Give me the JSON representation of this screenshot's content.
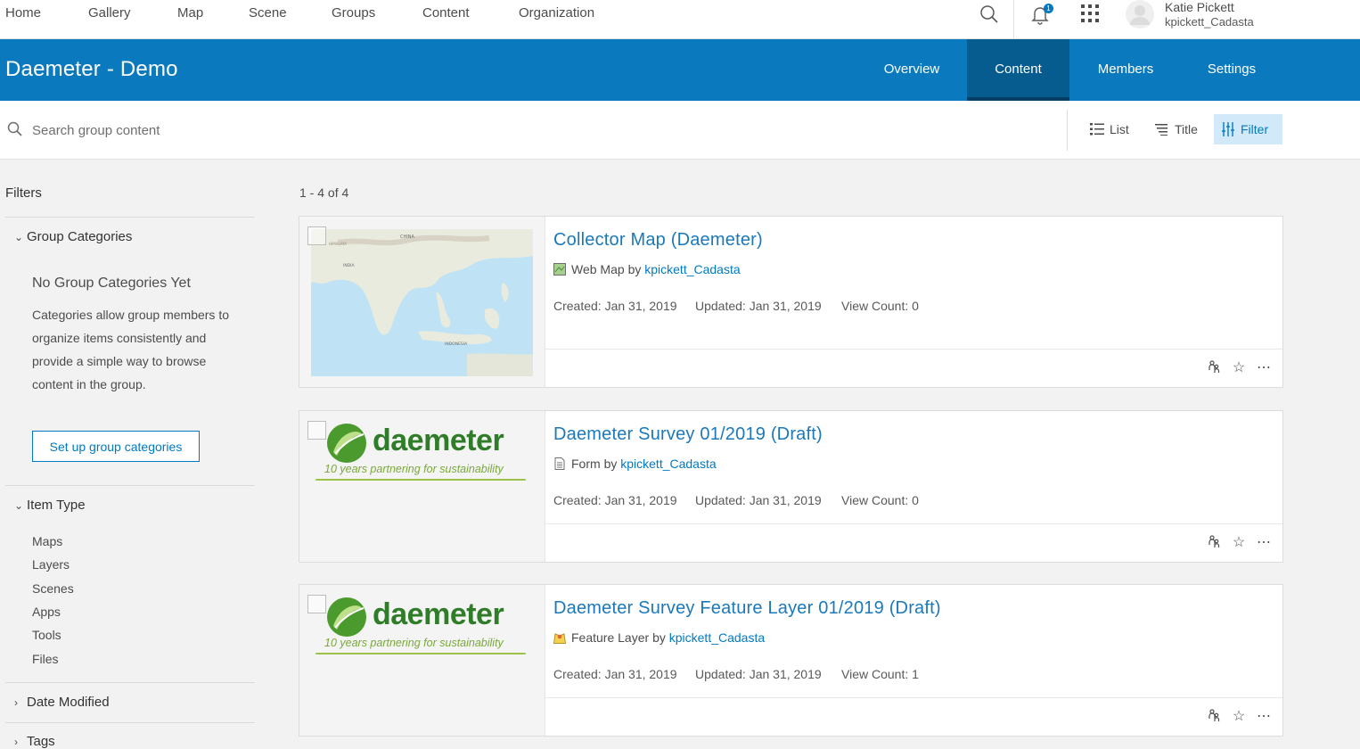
{
  "topnav": {
    "links": [
      "Home",
      "Gallery",
      "Map",
      "Scene",
      "Groups",
      "Content",
      "Organization"
    ],
    "notification_count": "1",
    "user": {
      "name": "Katie Pickett",
      "username": "kpickett_Cadasta"
    }
  },
  "group": {
    "title": "Daemeter - Demo",
    "tabs": [
      "Overview",
      "Content",
      "Members",
      "Settings"
    ],
    "active_tab": "Content"
  },
  "search": {
    "placeholder": "Search group content"
  },
  "view_controls": {
    "list": "List",
    "title": "Title",
    "filter": "Filter"
  },
  "sidebar": {
    "heading": "Filters",
    "group_categories": {
      "label": "Group Categories",
      "empty_title": "No Group Categories Yet",
      "empty_desc": "Categories allow group members to organize items consistently and provide a simple way to browse content in the group.",
      "setup_button": "Set up group categories"
    },
    "item_type": {
      "label": "Item Type",
      "options": [
        "Maps",
        "Layers",
        "Scenes",
        "Apps",
        "Tools",
        "Files"
      ]
    },
    "date_modified": "Date Modified",
    "tags": "Tags"
  },
  "results": {
    "count_text": "1 - 4 of 4",
    "items": [
      {
        "title": "Collector Map (Daemeter)",
        "type": "Web Map",
        "by": "by",
        "owner": "kpickett_Cadasta",
        "created": "Created: Jan 31, 2019",
        "updated": "Updated: Jan 31, 2019",
        "views": "View Count: 0"
      },
      {
        "title": "Daemeter Survey 01/2019 (Draft)",
        "type": "Form",
        "by": "by",
        "owner": "kpickett_Cadasta",
        "created": "Created: Jan 31, 2019",
        "updated": "Updated: Jan 31, 2019",
        "views": "View Count: 0"
      },
      {
        "title": "Daemeter Survey Feature Layer 01/2019 (Draft)",
        "type": "Feature Layer",
        "by": "by",
        "owner": "kpickett_Cadasta",
        "created": "Created: Jan 31, 2019",
        "updated": "Updated: Jan 31, 2019",
        "views": "View Count: 1"
      }
    ]
  },
  "map_labels": [
    "CHINA",
    "HIMALAYA",
    "INDIA",
    "INDONESIA"
  ],
  "logo": {
    "word": "daemeter",
    "tagline": "10 years partnering for sustainability"
  },
  "colors": {
    "brand_blue": "#0b79be",
    "link_blue": "#007ac2",
    "active_tab": "#065b8f"
  }
}
